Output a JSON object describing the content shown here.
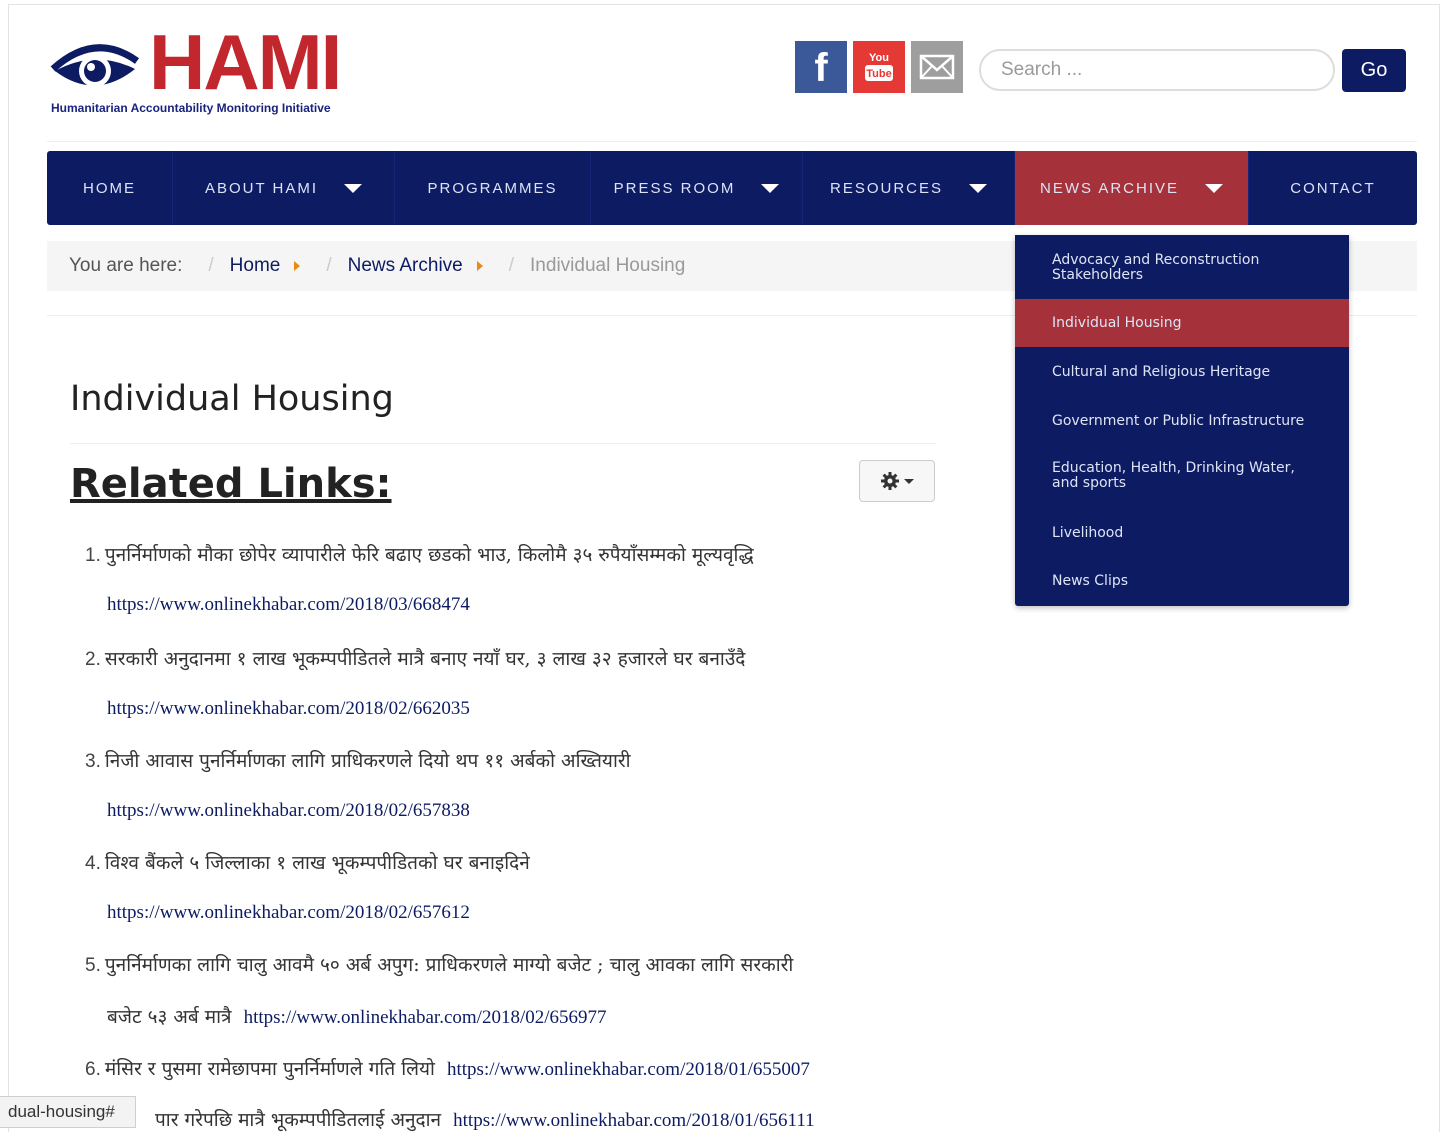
{
  "logo": {
    "text": "HAMI",
    "tagline": "Humanitarian Accountability Monitoring Initiative"
  },
  "social": [
    {
      "name": "facebook-icon",
      "glyph": "f"
    },
    {
      "name": "youtube-icon",
      "glyph": "You Tube"
    },
    {
      "name": "mail-icon",
      "glyph": "✉"
    }
  ],
  "search": {
    "placeholder": "Search ...",
    "button": "Go"
  },
  "nav": {
    "items": [
      {
        "label": "HOME",
        "dropdown": false
      },
      {
        "label": "ABOUT HAMI",
        "dropdown": true
      },
      {
        "label": "PROGRAMMES",
        "dropdown": false
      },
      {
        "label": "PRESS ROOM",
        "dropdown": true
      },
      {
        "label": "RESOURCES",
        "dropdown": true
      },
      {
        "label": "NEWS ARCHIVE",
        "dropdown": true,
        "active": true
      },
      {
        "label": "CONTACT",
        "dropdown": false
      }
    ]
  },
  "breadcrumb": {
    "label": "You are here:",
    "sep": "/",
    "home": "Home",
    "archive": "News Archive",
    "current": "Individual Housing"
  },
  "content": {
    "title": "Individual Housing",
    "related": "Related Links:",
    "items": [
      {
        "num": "1.",
        "text": "पुनर्निर्माणको मौका छोपेर व्यापारीले फेरि बढाए छडको भाउ, किलोमै ३५ रुपैयाँसम्मको मूल्यवृद्धि",
        "url": "https://www.onlinekhabar.com/2018/03/668474"
      },
      {
        "num": "2.",
        "text": "सरकारी अनुदानमा १ लाख भूकम्पपीडितले मात्रै बनाए नयाँ घर, ३ लाख ३२ हजारले घर बनाउँदै",
        "url": "https://www.onlinekhabar.com/2018/02/662035"
      },
      {
        "num": "3.",
        "text": "निजी आवास पुनर्निर्माणका लागि प्राधिकरणले दियो थप ११ अर्बको अख्तियारी",
        "url": "https://www.onlinekhabar.com/2018/02/657838"
      },
      {
        "num": "4.",
        "text": "विश्व बैंकले ५ जिल्लाका १ लाख भूकम्पपीडितको घर बनाइदिने",
        "url": "https://www.onlinekhabar.com/2018/02/657612"
      },
      {
        "num": "5.",
        "text": "पुनर्निर्माणका लागि चालु आवमै ५० अर्ब अपुग: प्राधिकरणले माग्यो बजेट ; चालु आवका लागि सरकारी",
        "text2": "बजेट ५३ अर्ब मात्रै",
        "url": "https://www.onlinekhabar.com/2018/02/656977"
      },
      {
        "num": "6.",
        "text": "मंसिर र पुसमा रामेछापमा पुनर्निर्माणले गति लियो",
        "url": "https://www.onlinekhabar.com/2018/01/655007"
      },
      {
        "text": "पार गरेपछि मात्रै भूकम्पपीडितलाई अनुदान",
        "url": "https://www.onlinekhabar.com/2018/01/656111"
      }
    ]
  },
  "dropdown": {
    "items": [
      {
        "label": "Advocacy and Reconstruction Stakeholders",
        "active": false
      },
      {
        "label": "Individual Housing",
        "active": true
      },
      {
        "label": "Cultural and Religious Heritage",
        "active": false
      },
      {
        "label": "Government or Public Infrastructure",
        "active": false
      },
      {
        "label": "Education, Health, Drinking Water, and sports",
        "active": false
      },
      {
        "label": "Livelihood",
        "active": false
      },
      {
        "label": "News Clips",
        "active": false
      }
    ]
  },
  "statusbar": {
    "text": "dual-housing#"
  },
  "colors": {
    "navy": "#0d1b63",
    "active_red": "#a5323a",
    "logo_red": "#c1272d",
    "breadcrumb_arrow": "#e88a16"
  }
}
